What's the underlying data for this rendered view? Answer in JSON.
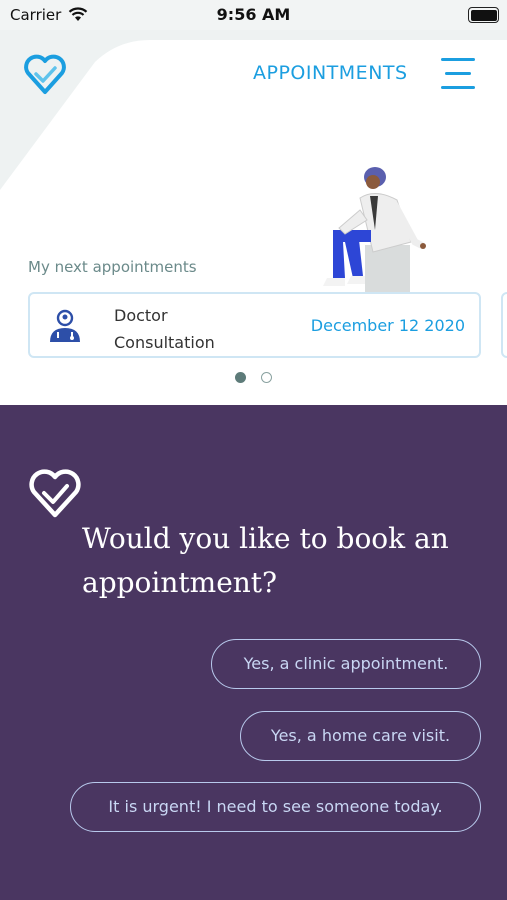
{
  "status_bar": {
    "carrier": "Carrier",
    "time": "9:56 AM",
    "wifi_icon": "wifi-icon",
    "battery_icon": "battery-icon"
  },
  "header": {
    "logo_icon": "heart-logo-icon",
    "nav_label": "APPOINTMENTS",
    "menu_icon": "menu-icon"
  },
  "appointments": {
    "section_label": "My next appointments",
    "cards": [
      {
        "icon": "doctor-icon",
        "title": "Doctor Consultation",
        "date": "December 12 2020"
      }
    ],
    "pagination": {
      "pages": 2,
      "current": 1
    }
  },
  "chat": {
    "logo_icon": "heart-logo-icon",
    "question": "Would you like to book an appointment?",
    "options": [
      "Yes, a clinic appointment.",
      "Yes, a home care visit.",
      "It is urgent! I need to see someone today."
    ]
  },
  "colors": {
    "accent": "#1b9ee0",
    "panel": "#4a3661",
    "option_border": "#b8c9ec",
    "muted_label": "#6b8a8a"
  }
}
